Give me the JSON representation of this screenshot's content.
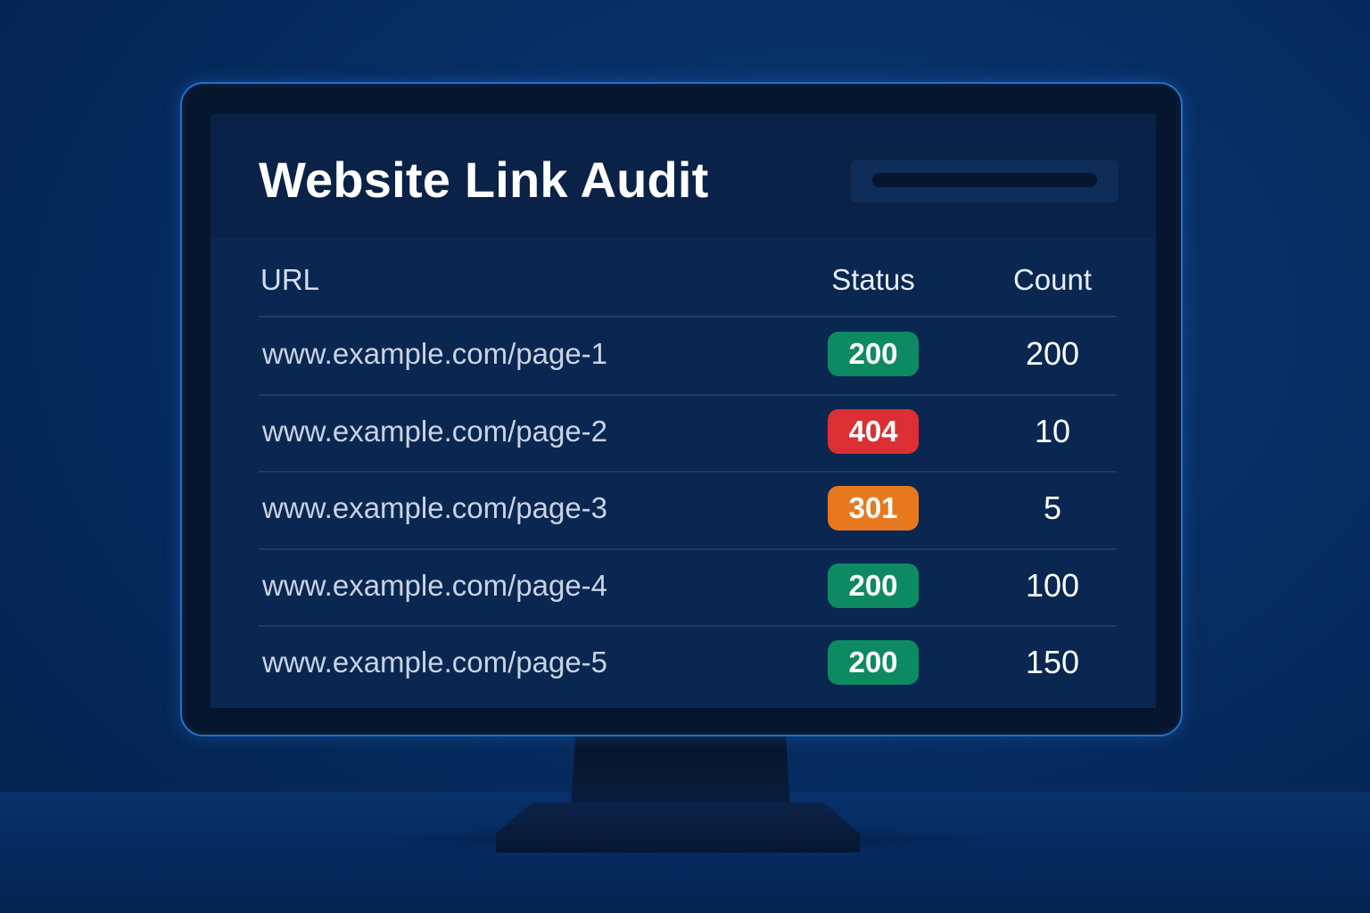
{
  "app": {
    "title": "Website Link Audit",
    "search": {
      "value": ""
    }
  },
  "table": {
    "columns": {
      "url": "URL",
      "status": "Status",
      "count": "Count"
    },
    "rows": [
      {
        "url": "www.example.com/page-1",
        "status": "200",
        "status_kind": "success",
        "count": "200"
      },
      {
        "url": "www.example.com/page-2",
        "status": "404",
        "status_kind": "error",
        "count": "10"
      },
      {
        "url": "www.example.com/page-3",
        "status": "301",
        "status_kind": "redirect",
        "count": "5"
      },
      {
        "url": "www.example.com/page-4",
        "status": "200",
        "status_kind": "success",
        "count": "100"
      },
      {
        "url": "www.example.com/page-5",
        "status": "200",
        "status_kind": "success",
        "count": "150"
      }
    ]
  },
  "colors": {
    "success": "#0e8a63",
    "error": "#dc2f34",
    "redirect": "#e8781e",
    "accent": "#2472c4"
  }
}
